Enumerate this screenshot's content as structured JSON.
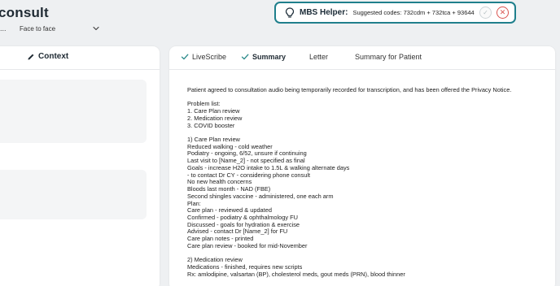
{
  "header": {
    "title": "consult",
    "type_ellipsis": "...",
    "consult_type": "Face to face"
  },
  "mbs_helper": {
    "title": "MBS Helper:",
    "codes_text": "Suggested codes: 732cdm + 732tca + 93644",
    "accept_symbol": "✓",
    "reject_symbol": "✕"
  },
  "left_panel": {
    "context_label": "Context"
  },
  "tabs": [
    {
      "label": "LiveScribe",
      "checked": true
    },
    {
      "label": "Summary",
      "checked": true,
      "active": true
    },
    {
      "label": "Letter",
      "checked": false
    },
    {
      "label": "Summary for Patient",
      "checked": false
    }
  ],
  "summary_lines": [
    "Patient agreed to consultation audio being temporarily recorded for transcription, and has been offered the Privacy Notice.",
    "",
    "Problem list:",
    "1. Care Plan review",
    "2. Medication review",
    "3. COVID booster",
    "",
    "1) Care Plan review",
    "Reduced walking - cold weather",
    "Podiatry - ongoing, 6/52, unsure if continuing",
    "Last visit to [Name_2] - not specified as final",
    "Goals - increase H2O intake to 1.5L & walking alternate days",
    "- to contact Dr CY - considering phone consult",
    "No new health concerns",
    "Bloods last month - NAD (FBE)",
    "Second shingles vaccine - administered, one each arm",
    "Plan:",
    "Care plan - reviewed & updated",
    "Confirmed - podiatry & ophthalmology FU",
    "Discussed - goals for hydration & exercise",
    "Advised - contact Dr [Name_2] for FU",
    "Care plan notes - printed",
    "Care plan review - booked for mid-November",
    "",
    "2) Medication review",
    "Medications - finished, requires new scripts",
    "Rx: amlodipine, valsartan (BP), cholesterol meds, gout meds (PRN), blood thinner"
  ],
  "colors": {
    "accent": "#1f7f8c",
    "check_green": "#2a8a8a",
    "reject_red": "#d9534f"
  }
}
